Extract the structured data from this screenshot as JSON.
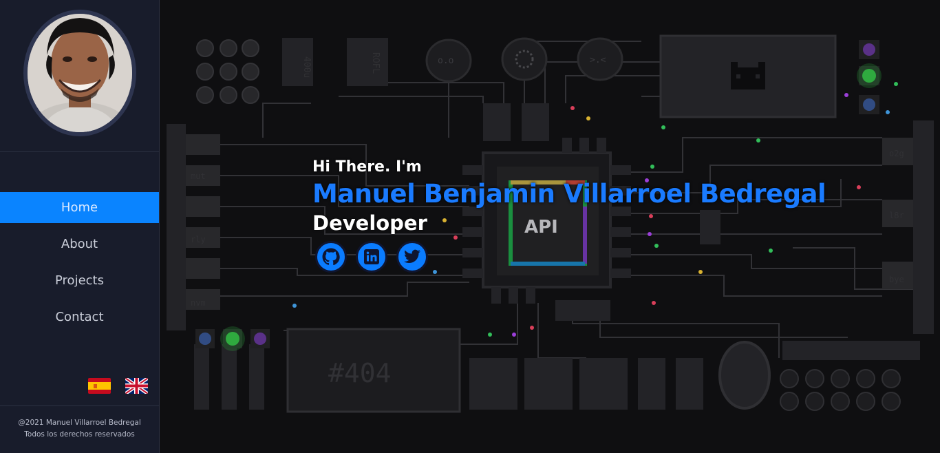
{
  "sidebar": {
    "nav": [
      {
        "label": "Home",
        "active": true
      },
      {
        "label": "About",
        "active": false
      },
      {
        "label": "Projects",
        "active": false
      },
      {
        "label": "Contact",
        "active": false
      }
    ],
    "languages": [
      {
        "icon": "spain-flag-icon"
      },
      {
        "icon": "uk-flag-icon"
      }
    ],
    "footer": {
      "copyright": "@2021 Manuel Villarroel Bedregal",
      "rights": "Todos los derechos reservados"
    }
  },
  "hero": {
    "greeting": "Hi There. I'm",
    "name": "Manuel Benjamin Villarroel Bedregal",
    "role": "Developer",
    "socials": [
      {
        "icon": "github-icon"
      },
      {
        "icon": "linkedin-icon"
      },
      {
        "icon": "twitter-icon"
      }
    ]
  },
  "background": {
    "chip_label": "API",
    "board_labels": [
      "400u",
      "ROFL",
      "o.o",
      ">.<",
      "#404",
      "mut",
      "rly",
      "nvm",
      "o2g",
      "l8r",
      "bye"
    ]
  },
  "colors": {
    "accent": "#0a84ff",
    "sidebar_bg": "#181c2b",
    "name_color": "#1a7bff"
  }
}
